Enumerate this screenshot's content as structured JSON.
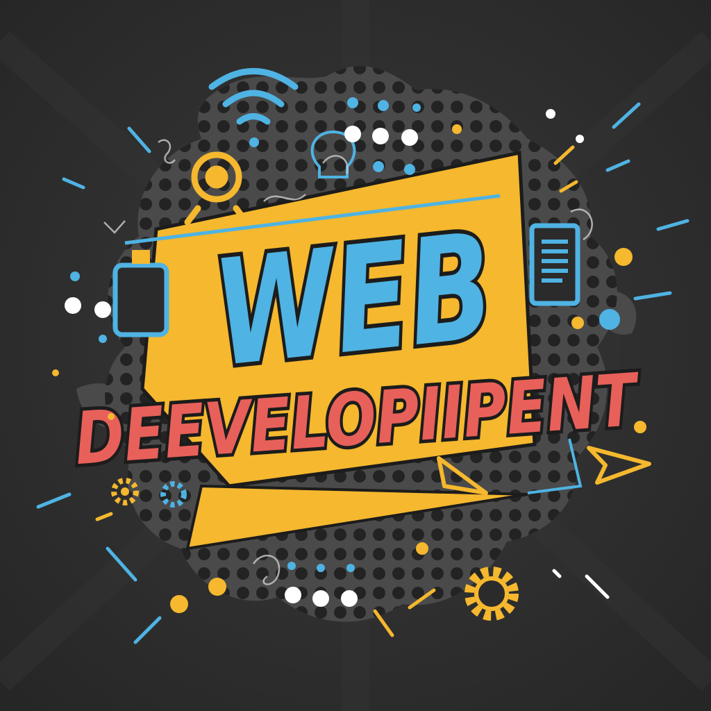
{
  "headline": {
    "line1": "WEB",
    "line2": "DEEVELOPIIPENT"
  },
  "colors": {
    "background": "#2b2b2b",
    "splat": "#4a4a4a",
    "halftone_dot": "#1f1f1f",
    "accent_yellow": "#f5b82e",
    "accent_blue": "#4fb3e3",
    "accent_red": "#e8605a",
    "outline": "#1c1c1c",
    "white": "#ffffff"
  },
  "icons": {
    "wifi": "wifi-icon",
    "webcam": "webcam-icon",
    "document": "document-icon",
    "mobile": "mobile-device-icon",
    "gear": "gear-icon",
    "cursor": "cursor-arrow-icon",
    "lightbulb": "lightbulb-icon"
  }
}
